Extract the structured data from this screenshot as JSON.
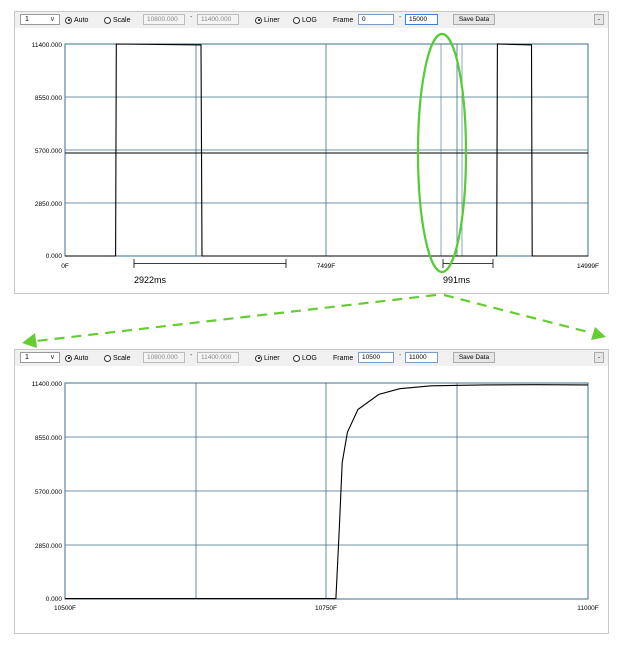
{
  "panels": [
    {
      "toolbar": {
        "channel_value": "1",
        "auto_label": "Auto",
        "scale_label": "Scale",
        "scale_min": "10800.000",
        "scale_max": "11400.000",
        "liner_label": "Liner",
        "log_label": "LOG",
        "frame_label": "Frame",
        "frame_start": "0",
        "frame_end": "15000",
        "save_label": "Save Data",
        "dash": "-",
        "collapse": "-",
        "auto_selected": true,
        "liner_selected": true
      },
      "y_ticks": [
        "11400.000",
        "8550.000",
        "5700.000",
        "2850.000",
        "0.000"
      ],
      "x_ticks": [
        "0F",
        "7499F",
        "14999F"
      ],
      "annotations": {
        "pulse1": "2922ms",
        "pulse2": "991ms"
      }
    },
    {
      "toolbar": {
        "channel_value": "1",
        "auto_label": "Auto",
        "scale_label": "Scale",
        "scale_min": "10800.000",
        "scale_max": "11400.000",
        "liner_label": "Liner",
        "log_label": "LOG",
        "frame_label": "Frame",
        "frame_start": "10500",
        "frame_end": "11000",
        "save_label": "Save Data",
        "dash": "-",
        "collapse": "-",
        "auto_selected": true,
        "liner_selected": true
      },
      "y_ticks": [
        "11400.000",
        "8550.000",
        "5700.000",
        "2850.000",
        "0.000"
      ],
      "x_ticks": [
        "10500F",
        "10750F",
        "11000F"
      ]
    }
  ],
  "colors": {
    "grid": "#3d6f8c",
    "trace": "#000000",
    "highlight": "#55cc33",
    "arrow": "#66cc33"
  },
  "chart_data": [
    {
      "type": "line",
      "title": "",
      "xlabel": "",
      "ylabel": "",
      "ylim": [
        0,
        11400
      ],
      "xlim": [
        0,
        14999
      ],
      "threshold": 5550,
      "series": [
        {
          "x": [
            0,
            1450,
            1470,
            3900,
            3930,
            5150,
            5180,
            12380,
            12400,
            13380,
            13400,
            14999
          ],
          "values": [
            0,
            0,
            11400,
            11350,
            0,
            0,
            0,
            0,
            11400,
            11350,
            0,
            0
          ]
        }
      ]
    },
    {
      "type": "line",
      "title": "",
      "xlabel": "",
      "ylabel": "",
      "ylim": [
        0,
        11400
      ],
      "xlim": [
        10500,
        11000
      ],
      "series": [
        {
          "x": [
            10500,
            10700,
            10759,
            10762,
            10765,
            10770,
            10780,
            10800,
            10820,
            10850,
            10900,
            10950,
            11000
          ],
          "values": [
            20,
            20,
            20,
            3500,
            7200,
            8800,
            10000,
            10800,
            11100,
            11250,
            11300,
            11310,
            11300
          ]
        }
      ]
    }
  ]
}
